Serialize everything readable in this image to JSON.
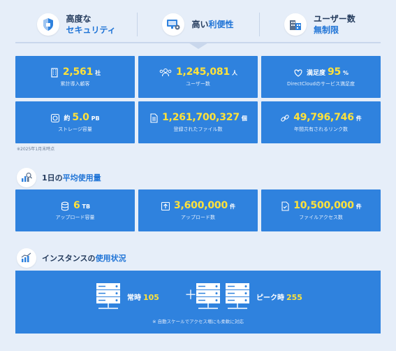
{
  "features": [
    {
      "line1": "高度な",
      "line2": "セキュリティ",
      "icon": "shield-icon"
    },
    {
      "line1": "高い",
      "line1_hl": "利便性",
      "icon": "monitor-gear-icon"
    },
    {
      "line1": "ユーザー数",
      "line2": "無制限",
      "icon": "buildings-icon"
    }
  ],
  "stats": [
    {
      "icon": "building-icon",
      "value": "2,561",
      "unit": "社",
      "label": "累計導入顧客"
    },
    {
      "icon": "users-icon",
      "value": "1,245,081",
      "unit": "人",
      "label": "ユーザー数"
    },
    {
      "icon": "heart-icon",
      "prefix": "満足度",
      "value": "95",
      "unit": "%",
      "label": "DirectCloudのサービス満足度"
    },
    {
      "icon": "storage-icon",
      "prefix": "約",
      "value": "5.0",
      "unit": "PB",
      "label": "ストレージ容量"
    },
    {
      "icon": "file-icon",
      "value": "1,261,700,327",
      "unit": "個",
      "label": "登録されたファイル数"
    },
    {
      "icon": "link-icon",
      "value": "49,796,746",
      "unit": "件",
      "label": "年間共有されるリンク数"
    }
  ],
  "note": "※2025年1月末時点",
  "daily": {
    "title_pre": "1日の",
    "title_hl": "平均使用量",
    "icon": "chart-search-icon",
    "items": [
      {
        "icon": "database-icon",
        "value": "6",
        "unit": "TB",
        "label": "アップロード容量"
      },
      {
        "icon": "upload-icon",
        "value": "3,600,000",
        "unit": "件",
        "label": "アップロード数"
      },
      {
        "icon": "file-check-icon",
        "value": "10,500,000",
        "unit": "件",
        "label": "ファイルアクセス数"
      }
    ]
  },
  "instances": {
    "title_pre": "インスタンスの",
    "title_hl": "使用状況",
    "icon": "bar-chart-icon",
    "always_label": "常時",
    "always_value": "105",
    "peak_label": "ピーク時",
    "peak_value": "255",
    "plus": "＋",
    "note": "※ 自動スケールでアクセス増にも柔軟に対応"
  },
  "colors": {
    "card": "#2f82de",
    "highlight": "#ffe23a",
    "accent": "#1e73d6",
    "background": "#e6eef9"
  }
}
